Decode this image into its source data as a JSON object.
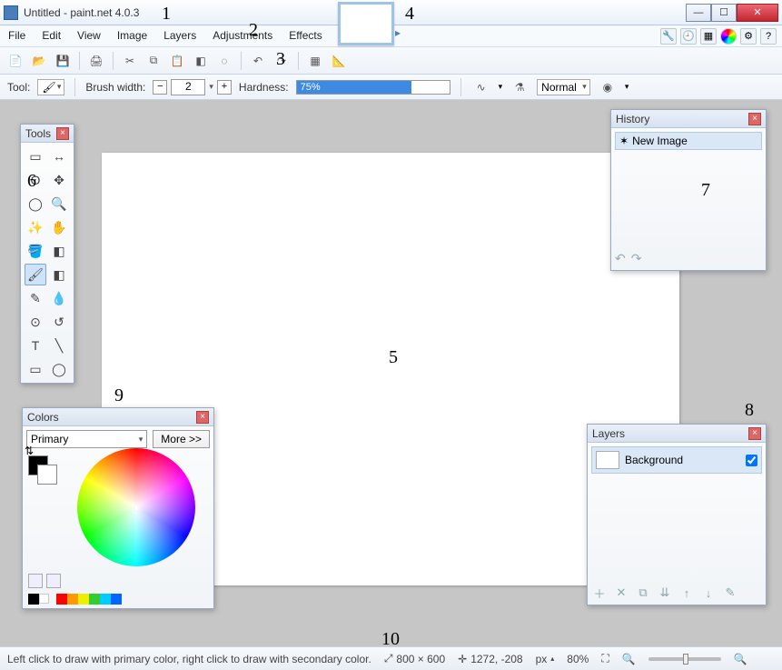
{
  "window": {
    "title": "Untitled - paint.net 4.0.3"
  },
  "menus": [
    "File",
    "Edit",
    "View",
    "Image",
    "Layers",
    "Adjustments",
    "Effects"
  ],
  "toolbar_icons": [
    "new",
    "open",
    "save",
    "print",
    "cut",
    "copy",
    "paste",
    "crop",
    "deselect",
    "undo",
    "redo",
    "grid",
    "ruler"
  ],
  "options": {
    "tool_label": "Tool:",
    "brush_label": "Brush width:",
    "brush_value": "2",
    "hardness_label": "Hardness:",
    "hardness_value": "75%",
    "hardness_pct": 75,
    "blend_label": "Normal"
  },
  "tools_panel": {
    "title": "Tools",
    "items": [
      "rect-select",
      "move-sel",
      "lasso",
      "move-pix",
      "ellipse-select",
      "zoom",
      "magic-wand",
      "pan",
      "paint-bucket",
      "gradient",
      "paintbrush",
      "eraser",
      "pencil",
      "color-picker",
      "clone",
      "recolor",
      "text",
      "line",
      "rect-shape",
      "ellipse-shape"
    ]
  },
  "history_panel": {
    "title": "History",
    "entries": [
      "New Image"
    ]
  },
  "colors_panel": {
    "title": "Colors",
    "which": "Primary",
    "more": "More >>",
    "palette": [
      "#000000",
      "#ff0000",
      "#ff9900",
      "#f4e500",
      "#33cc33",
      "#00ccff",
      "#0066ff",
      "#000000"
    ]
  },
  "layers_panel": {
    "title": "Layers",
    "rows": [
      {
        "name": "Background",
        "visible": true
      }
    ]
  },
  "status": {
    "hint": "Left click to draw with primary color, right click to draw with secondary color.",
    "size": "800 × 600",
    "cursor": "1272, -208",
    "units": "px",
    "zoom": "80%"
  },
  "annotations": {
    "1": "1",
    "2": "2",
    "3": "3",
    "4": "4",
    "5": "5",
    "6": "6",
    "7": "7",
    "8": "8",
    "9": "9",
    "10": "10"
  }
}
